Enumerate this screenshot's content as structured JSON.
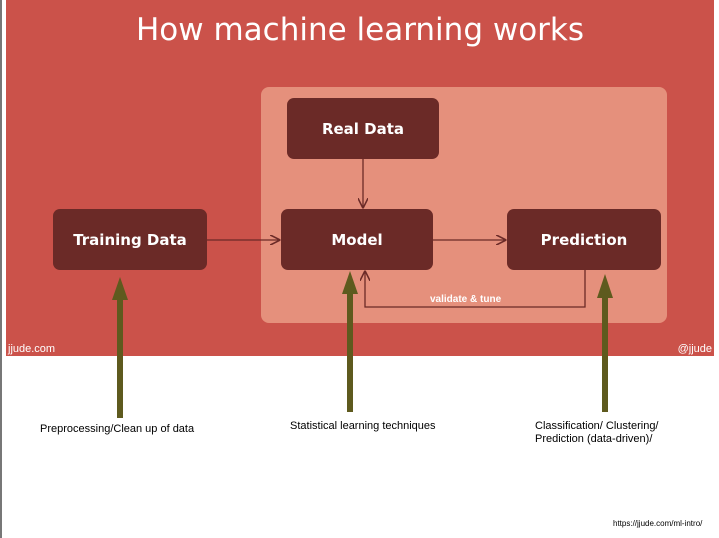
{
  "title": "How machine learning works",
  "boxes": {
    "real_data": "Real Data",
    "training_data": "Training Data",
    "model": "Model",
    "prediction": "Prediction"
  },
  "loop_label": "validate & tune",
  "footer_left": "jjude.com",
  "footer_right": "@jjude",
  "captions": {
    "preprocessing": "Preprocessing/Clean up of data",
    "statistical": "Statistical learning techniques",
    "classification": "Classification/ Clustering/ Prediction (data-driven)/"
  },
  "url": "https://jjude.com/ml-intro/",
  "colors": {
    "slide": "#cb524a",
    "panel": "#e5907c",
    "box": "#6b2a27",
    "arrow": "#5e5a1e"
  }
}
